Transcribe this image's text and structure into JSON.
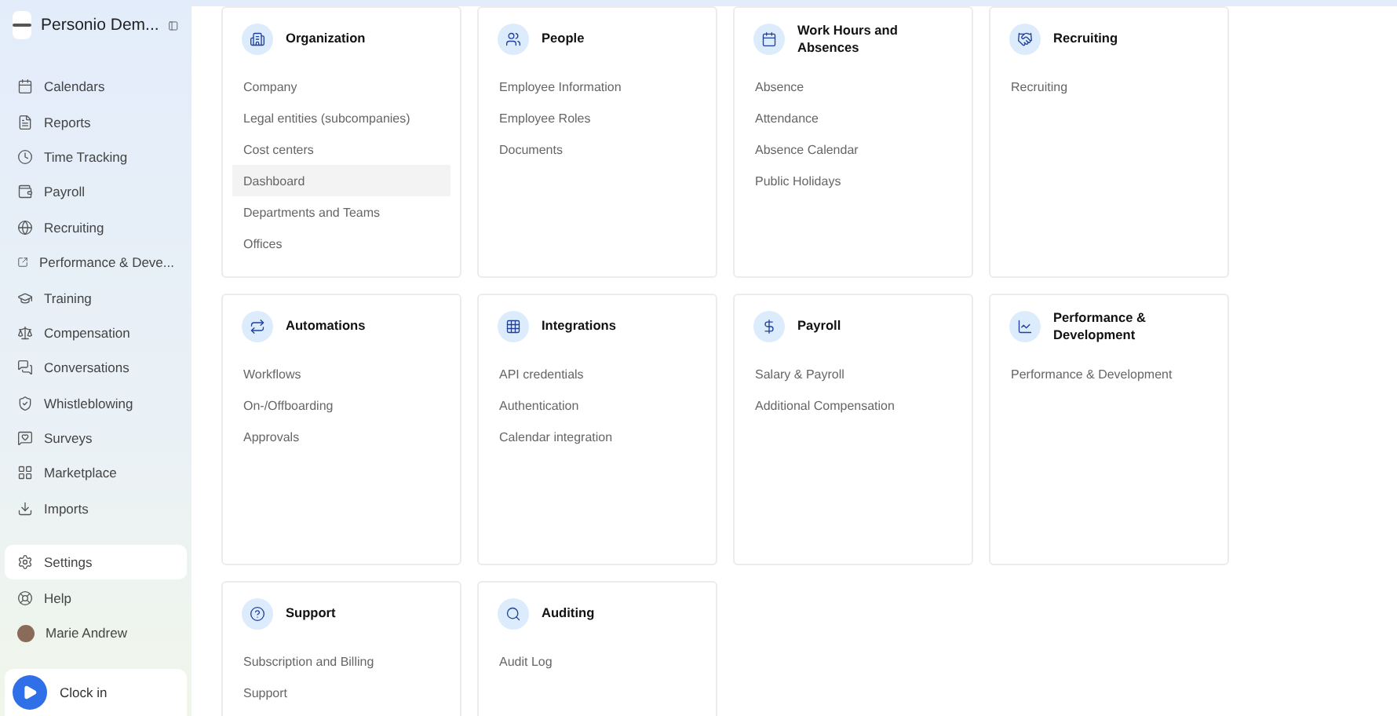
{
  "sidebar": {
    "company": "Personio Dem...",
    "items": [
      {
        "label": "Calendars",
        "selected": false
      },
      {
        "label": "Reports",
        "selected": false
      },
      {
        "label": "Time Tracking",
        "selected": false
      },
      {
        "label": "Payroll",
        "selected": false
      },
      {
        "label": "Recruiting",
        "selected": false
      },
      {
        "label": "Performance & Deve...",
        "selected": false
      },
      {
        "label": "Training",
        "selected": false
      },
      {
        "label": "Compensation",
        "selected": false
      },
      {
        "label": "Conversations",
        "selected": false
      },
      {
        "label": "Whistleblowing",
        "selected": false
      },
      {
        "label": "Surveys",
        "selected": false
      },
      {
        "label": "Marketplace",
        "selected": false
      },
      {
        "label": "Imports",
        "selected": false
      }
    ],
    "bottom_items": [
      {
        "label": "Settings",
        "selected": true
      },
      {
        "label": "Help",
        "selected": false
      },
      {
        "label": "Marie Andrew",
        "selected": false
      }
    ],
    "clock_in": "Clock in"
  },
  "cards": [
    {
      "title": "Organization",
      "items": [
        {
          "label": "Company",
          "selected": false
        },
        {
          "label": "Legal entities (subcompanies)",
          "selected": false
        },
        {
          "label": "Cost centers",
          "selected": false
        },
        {
          "label": "Dashboard",
          "selected": true
        },
        {
          "label": "Departments and Teams",
          "selected": false
        },
        {
          "label": "Offices",
          "selected": false
        }
      ]
    },
    {
      "title": "People",
      "items": [
        {
          "label": "Employee Information",
          "selected": false
        },
        {
          "label": "Employee Roles",
          "selected": false
        },
        {
          "label": "Documents",
          "selected": false
        }
      ]
    },
    {
      "title": "Work Hours and Absences",
      "items": [
        {
          "label": "Absence",
          "selected": false
        },
        {
          "label": "Attendance",
          "selected": false
        },
        {
          "label": "Absence Calendar",
          "selected": false
        },
        {
          "label": "Public Holidays",
          "selected": false
        }
      ]
    },
    {
      "title": "Recruiting",
      "items": [
        {
          "label": "Recruiting",
          "selected": false
        }
      ]
    },
    {
      "title": "Automations",
      "items": [
        {
          "label": "Workflows",
          "selected": false
        },
        {
          "label": "On-/Offboarding",
          "selected": false
        },
        {
          "label": "Approvals",
          "selected": false
        }
      ]
    },
    {
      "title": "Integrations",
      "items": [
        {
          "label": "API credentials",
          "selected": false
        },
        {
          "label": "Authentication",
          "selected": false
        },
        {
          "label": "Calendar integration",
          "selected": false
        }
      ]
    },
    {
      "title": "Payroll",
      "items": [
        {
          "label": "Salary & Payroll",
          "selected": false
        },
        {
          "label": "Additional Compensation",
          "selected": false
        }
      ]
    },
    {
      "title": "Performance & Development",
      "items": [
        {
          "label": "Performance & Development",
          "selected": false
        }
      ]
    },
    {
      "title": "Support",
      "items": [
        {
          "label": "Subscription and Billing",
          "selected": false
        },
        {
          "label": "Support",
          "selected": false
        }
      ]
    },
    {
      "title": "Auditing",
      "items": [
        {
          "label": "Audit Log",
          "selected": false
        }
      ]
    }
  ]
}
